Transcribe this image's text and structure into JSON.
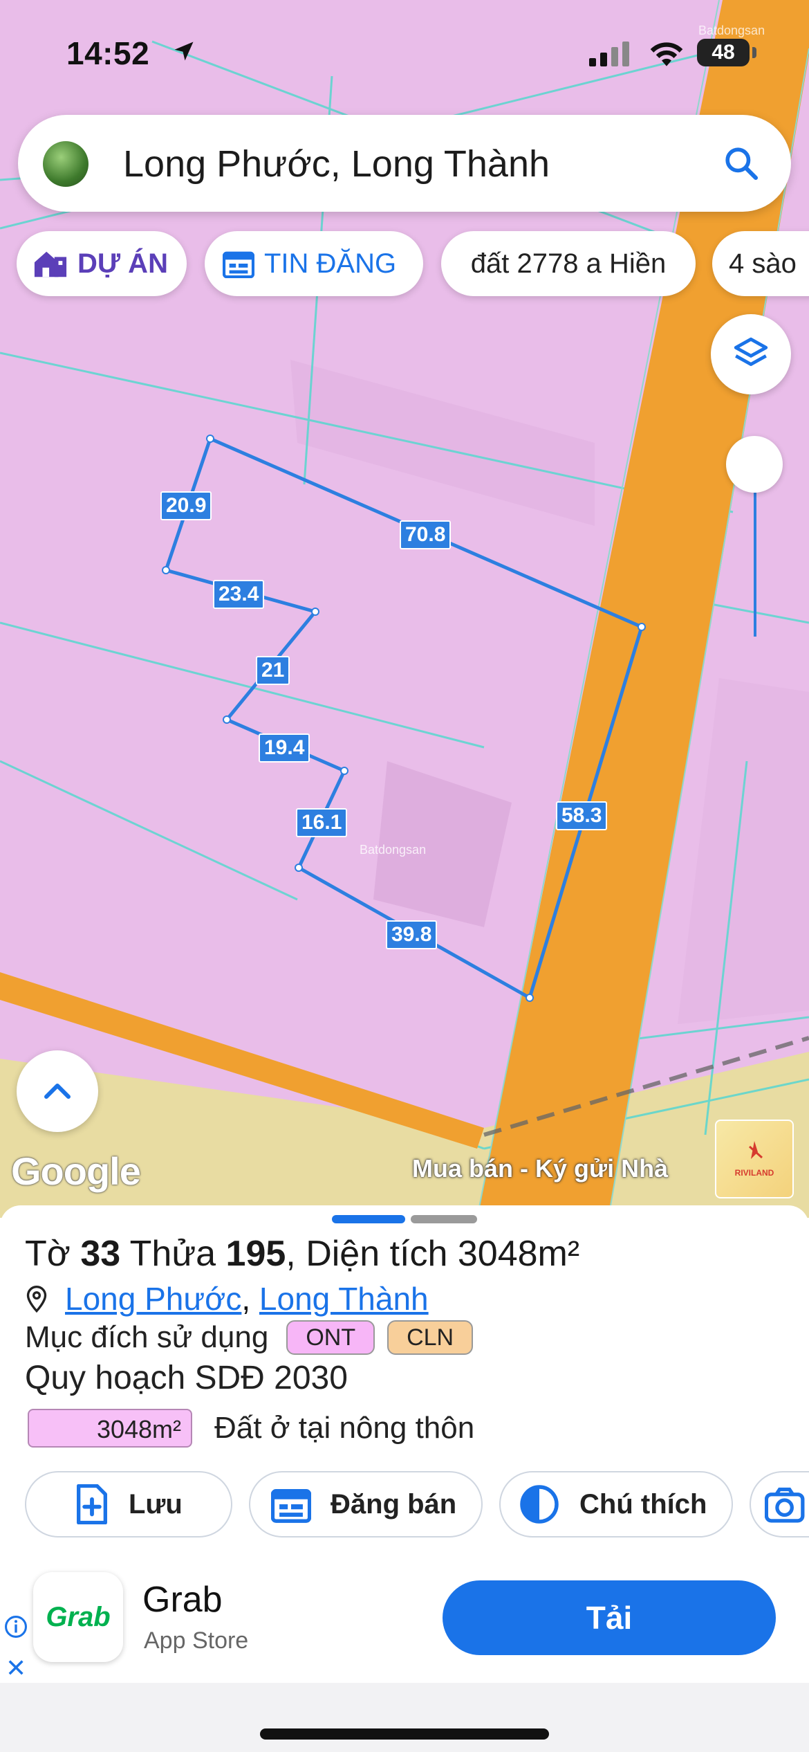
{
  "status_bar": {
    "time": "14:52",
    "battery": "48",
    "watermark": "Batdongsan"
  },
  "search": {
    "query": "Long Phước, Long Thành",
    "avatar_icon": "location-photo-icon",
    "search_icon": "search-icon"
  },
  "chips": [
    {
      "label": "DỰ ÁN",
      "icon": "project-home-icon",
      "color": "#5b3fb8"
    },
    {
      "label": "TIN ĐĂNG",
      "icon": "calendar-listing-icon",
      "color": "#1a73e8"
    },
    {
      "label": "đất 2778 a Hiền"
    },
    {
      "label": "4 sào"
    }
  ],
  "map": {
    "edge_lengths": [
      "20.9",
      "70.8",
      "23.4",
      "21",
      "19.4",
      "16.1",
      "58.3",
      "39.8"
    ],
    "watermark": "Batdongsan",
    "attribution": "Google",
    "overlay_text": "Mua bán - Ký gửi Nhà",
    "logo_text": "RIVILAND",
    "colors": {
      "residential": "#e9bde9",
      "road": "#f0a030",
      "parcel_outline": "#2d7fe0",
      "cadastral": "#5fd6cf",
      "farmland": "#e8dca2"
    }
  },
  "sheet": {
    "title_prefix": "Tờ ",
    "sheet_no": "33",
    "plot_prefix": " Thửa ",
    "plot_no": "195",
    "area_prefix": ", Diện tích ",
    "area_value": "3048m²",
    "ward": "Long Phước",
    "separator": ", ",
    "district": "Long Thành",
    "purpose_label": "Mục đích sử dụng",
    "tags": [
      "ONT",
      "CLN"
    ],
    "plan_label": "Quy hoạch SDĐ 2030",
    "plan_area": "3048m²",
    "plan_desc": "Đất ở tại nông thôn",
    "actions": [
      {
        "label": "Lưu",
        "icon": "save-file-icon"
      },
      {
        "label": "Đăng bán",
        "icon": "post-listing-icon"
      },
      {
        "label": "Chú thích",
        "icon": "legend-contrast-icon"
      },
      {
        "label": "",
        "icon": "camera-icon"
      }
    ]
  },
  "ad": {
    "app_name": "Grab",
    "store": "App Store",
    "icon_text": "Grab",
    "cta": "Tải"
  }
}
